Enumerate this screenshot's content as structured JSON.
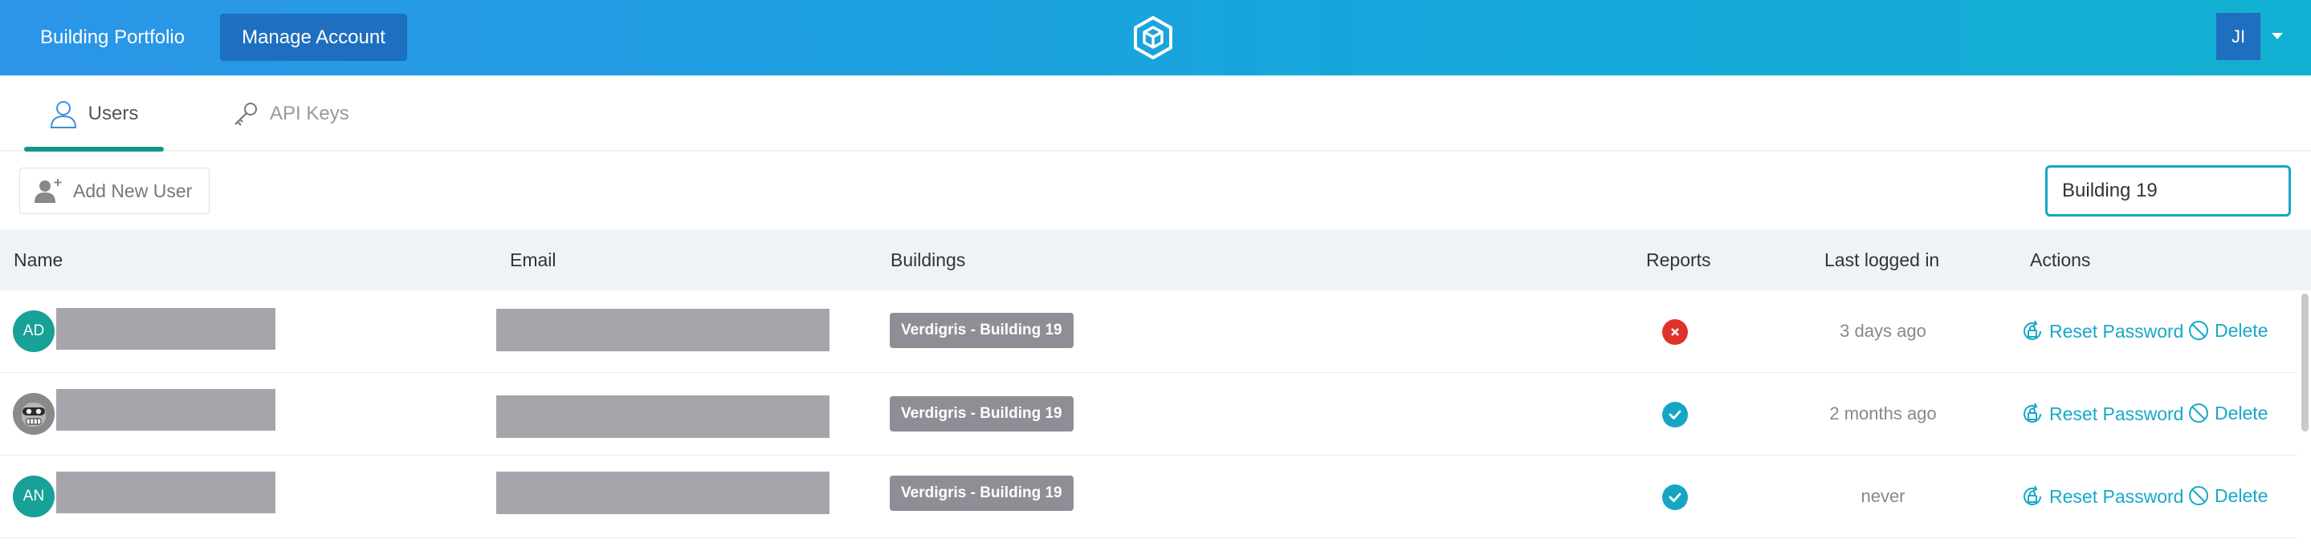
{
  "header": {
    "portfolio_label": "Building Portfolio",
    "manage_label": "Manage Account",
    "user_initials": "JI",
    "brand_color": "#2c95e8",
    "logo_icon": "cube-hexagon-logo-icon"
  },
  "tabs": [
    {
      "label": "Users",
      "icon": "user-icon",
      "active": true
    },
    {
      "label": "API Keys",
      "icon": "key-icon",
      "active": false
    }
  ],
  "toolbar": {
    "add_user_label": "Add New User",
    "search_value": "Building 19"
  },
  "table": {
    "headers": {
      "name": "Name",
      "email": "Email",
      "buildings": "Buildings",
      "reports": "Reports",
      "last": "Last logged in",
      "actions": "Actions"
    },
    "rows": [
      {
        "initials": "AD",
        "avatar_type": "initials",
        "building": "Verdigris - Building 19",
        "reports": "fail",
        "last": "3 days ago",
        "reset_label": "Reset Password",
        "delete_label": "Delete"
      },
      {
        "initials": "",
        "avatar_type": "robot-image",
        "building": "Verdigris - Building 19",
        "reports": "ok",
        "last": "2 months ago",
        "reset_label": "Reset Password",
        "delete_label": "Delete"
      },
      {
        "initials": "AN",
        "avatar_type": "initials",
        "building": "Verdigris - Building 19",
        "reports": "ok",
        "last": "never",
        "reset_label": "Reset Password",
        "delete_label": "Delete"
      }
    ]
  },
  "colors": {
    "accent": "#16a6c4",
    "active_tab": "#12968a",
    "status_fail": "#e0322b",
    "status_ok": "#16a6c4",
    "badge": "#8e8f96"
  }
}
